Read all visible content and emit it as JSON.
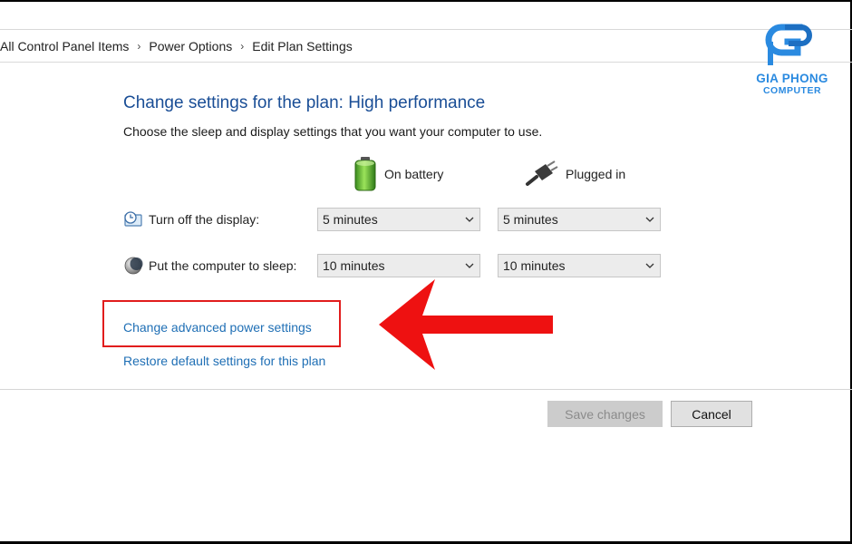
{
  "breadcrumb": {
    "items": [
      "All Control Panel Items",
      "Power Options",
      "Edit Plan Settings"
    ]
  },
  "logo": {
    "name": "GIA PHONG",
    "sub": "COMPUTER",
    "color": "#2a8ae0"
  },
  "plan": {
    "title": "Change settings for the plan: High performance",
    "subtitle": "Choose the sleep and display settings that you want your computer to use."
  },
  "columns": {
    "battery": {
      "label": "On battery",
      "icon": "battery-icon"
    },
    "plugged": {
      "label": "Plugged in",
      "icon": "power-plug-icon"
    }
  },
  "settings": {
    "display": {
      "label": "Turn off the display:",
      "icon": "display-timer-icon",
      "battery": "5 minutes",
      "plugged": "5 minutes"
    },
    "sleep": {
      "label": "Put the computer to sleep:",
      "icon": "moon-icon",
      "battery": "10 minutes",
      "plugged": "10 minutes"
    }
  },
  "links": {
    "advanced": "Change advanced power settings",
    "restore": "Restore default settings for this plan"
  },
  "buttons": {
    "save": "Save changes",
    "cancel": "Cancel"
  },
  "colors": {
    "title": "#1a4e96",
    "link": "#1f6fb5",
    "highlight": "#e11d1d"
  }
}
